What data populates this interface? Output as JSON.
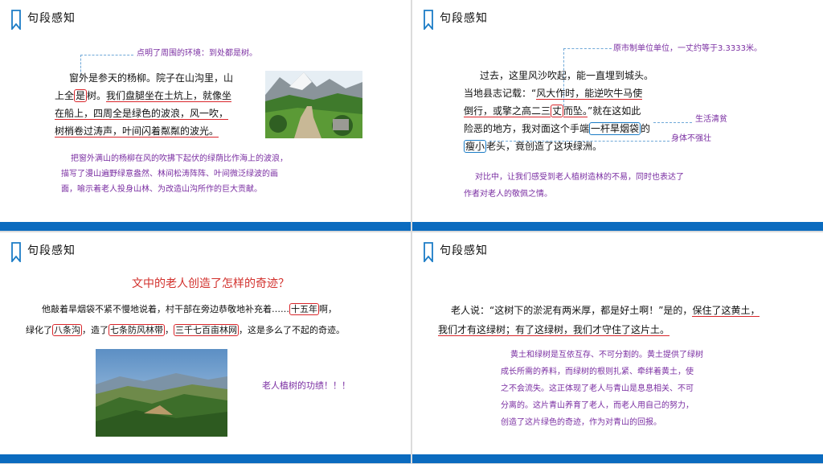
{
  "slide1": {
    "title": "句段感知",
    "annotation_top": "点明了周围的环境：到处都是树。",
    "l1a": "窗外是参天的杨柳。院子在山沟里，山",
    "l2a": "上全",
    "l2b": "是",
    "l2c": "树。",
    "l2d": "我们盘腿坐在土炕上，就像坐",
    "l3a": "在船上，四周全是绿色的波浪，风一吹，",
    "l4a": "树梢卷过涛声，叶间闪着粼粼的波光。",
    "explain": [
      "把窗外满山的杨柳在风的吹拂下起伏的绿荫比作海上的波浪，",
      "描写了漫山遍野绿意盎然、林间松涛阵阵、叶间微泛绿波的画",
      "面，喻示着老人投身山林、为改造山沟所作的巨大贡献。"
    ]
  },
  "slide2": {
    "title": "句段感知",
    "annotation_top": "原市制单位单位，一丈约等于3.3333米。",
    "l1": "过去，这里风沙吹起，能一直埋到城头。",
    "l2a": "当地县志记载：“",
    "l2b": "风大作时，能逆吹牛马使",
    "l3a": "倒行，或擎之高二三",
    "l3b": "丈",
    "l3c": "而坠。",
    "l3d": "”就在这如此",
    "l4a": "险恶的地方，我对面这个手端",
    "l4b": "一杆旱烟袋",
    "l4c": "的",
    "l5a": "瘦小",
    "l5b": "老头，竟创造了这块绿洲。",
    "side1": "生活清贫",
    "side2": "身体不强壮",
    "explain": [
      "对比中，让我们感受到老人植树造林的不易，同时也表达了",
      "作者对老人的敬佩之情。"
    ]
  },
  "slide3": {
    "title": "句段感知",
    "question": "文中的老人创造了怎样的奇迹？",
    "l1a": "他敲着旱烟袋不紧不慢地说着，村干部在旁边恭敬地补充着……",
    "l1b": "十五年",
    "l1c": "啊，",
    "l2a": "绿化了",
    "l2b": "八条沟",
    "l2c": "，造了",
    "l2d": "七条防风林带",
    "l2e": "，",
    "l2f": "三千七百亩林网",
    "l2g": "，这是多么了不起的奇迹。",
    "caption": "老人植树的功绩！！！"
  },
  "slide4": {
    "title": "句段感知",
    "l1a": "老人说：“这树下的淤泥有两米厚，都是好土啊！”是的，",
    "l1b": "保住了这黄土，",
    "l2a": "我们才有这绿树；有了这绿树，我们才守住了这片土。",
    "explain": [
      "黄土和绿树是互依互存、不可分割的。黄土提供了绿树",
      "成长所需的养料，而绿树的根则扎紧、牵绊着黄土，使",
      "之不会流失。这正体现了老人与青山是息息相关、不可",
      "分离的。这片青山养育了老人，而老人用自己的努力，",
      "创造了这片绿色的奇迹，作为对青山的回报。"
    ]
  },
  "colors": {
    "accent_blue": "#0b6bbf",
    "annotation_purple": "#7a2ea2",
    "mark_red": "#d9262b",
    "question_red": "#d2302c"
  },
  "icons": {
    "bookmark": "bookmark-icon"
  }
}
